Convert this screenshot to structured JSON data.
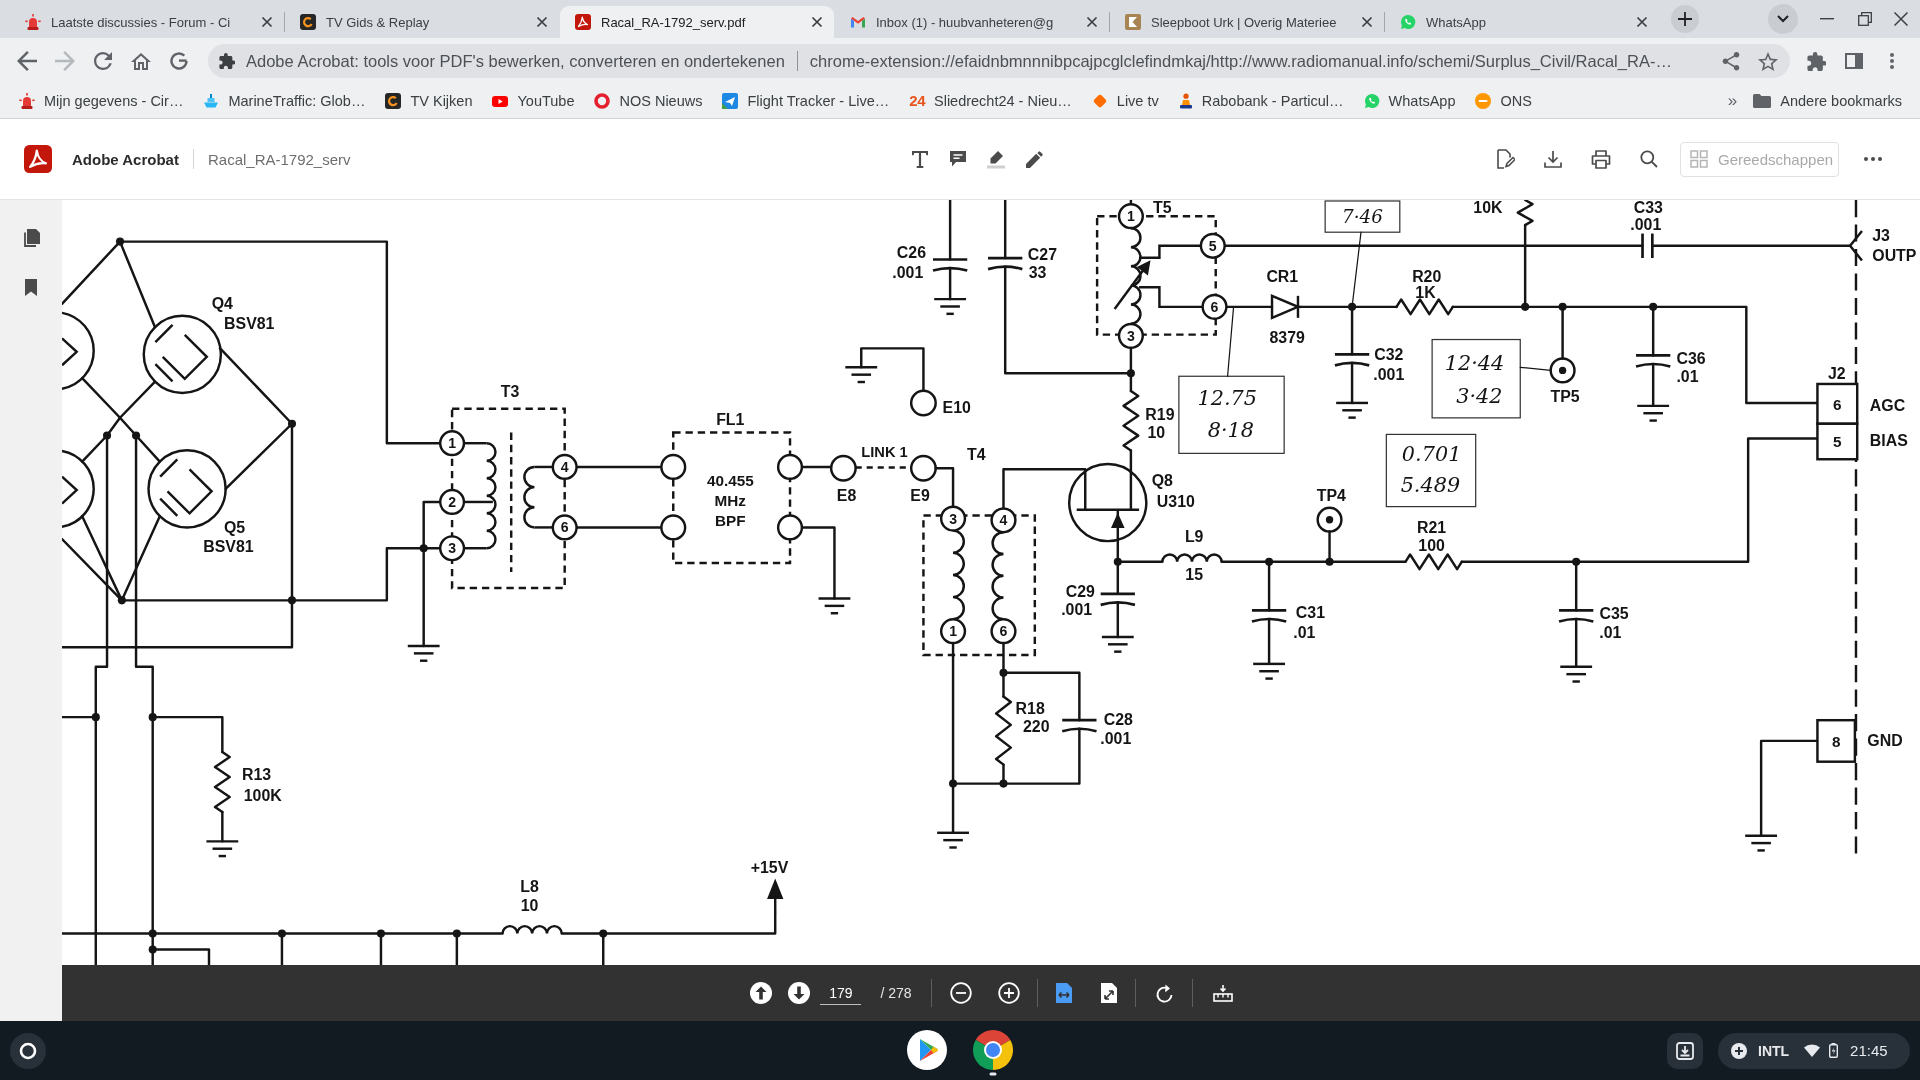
{
  "browser": {
    "tabs": [
      {
        "title": "Laatste discussies - Forum - Ci",
        "selected": false
      },
      {
        "title": "TV Gids & Replay",
        "selected": false
      },
      {
        "title": "Racal_RA-1792_serv.pdf",
        "selected": true
      },
      {
        "title": "Inbox (1) - huubvanheteren@g",
        "selected": false
      },
      {
        "title": "Sleepboot Urk | Overig Materiee",
        "selected": false
      },
      {
        "title": "WhatsApp",
        "selected": false
      }
    ],
    "navigation": {
      "back_disabled": false,
      "forward_disabled": true
    },
    "address_bar": {
      "page_title": "Adobe Acrobat: tools voor PDF's bewerken, converteren en ondertekenen",
      "url": "chrome-extension://efaidnbmnnnibpcajpcglclefindmkaj/http://www.radiomanual.info/schemi/Surplus_Civil/Racal_RA-…"
    },
    "bookmarks": [
      {
        "label": "Mijn gegevens - Cir…"
      },
      {
        "label": "MarineTraffic: Glob…"
      },
      {
        "label": "TV Kijken"
      },
      {
        "label": "YouTube"
      },
      {
        "label": "NOS Nieuws"
      },
      {
        "label": "Flight Tracker - Live…"
      },
      {
        "label": "Sliedrecht24 - Nieu…",
        "icon_text": "24"
      },
      {
        "label": "Live tv"
      },
      {
        "label": "Rabobank - Particul…"
      },
      {
        "label": "WhatsApp"
      },
      {
        "label": "ONS"
      }
    ],
    "bookmarks_overflow": "»",
    "other_bookmarks": "Andere bookmarks"
  },
  "acrobat": {
    "app_name": "Adobe Acrobat",
    "document_title": "Racal_RA-1792_serv",
    "tools_button": {
      "label": "Gereedschappen",
      "disabled": true
    }
  },
  "schematic": {
    "components": [
      {
        "kind": "transistor",
        "reference": "Q4",
        "value": "BSV81"
      },
      {
        "kind": "transistor",
        "reference": "Q5",
        "value": "BSV81"
      },
      {
        "kind": "resistor",
        "reference": "R13",
        "value": "100K"
      },
      {
        "kind": "transformer",
        "reference": "T3",
        "pins": [
          "1",
          "2",
          "3",
          "4",
          "6"
        ]
      },
      {
        "kind": "filter",
        "reference": "FL1",
        "value_lines": [
          "40.455",
          "MHz",
          "BPF"
        ]
      },
      {
        "kind": "inductor",
        "reference": "L8",
        "value": "10"
      },
      {
        "kind": "capacitor",
        "reference": "C26",
        "value": ".001"
      },
      {
        "kind": "capacitor",
        "reference": "C27",
        "value": "33"
      },
      {
        "kind": "transformer",
        "reference": "T4",
        "pins": [
          "3",
          "4",
          "1",
          "6"
        ]
      },
      {
        "kind": "resistor",
        "reference": "R18",
        "value": "220"
      },
      {
        "kind": "capacitor",
        "reference": "C28",
        "value": ".001"
      },
      {
        "kind": "transformer",
        "reference": "T5",
        "pins": [
          "1",
          "5",
          "6",
          "3"
        ]
      },
      {
        "kind": "resistor",
        "reference": "R19",
        "value": "10"
      },
      {
        "kind": "transistor",
        "reference": "Q8",
        "value": "U310"
      },
      {
        "kind": "capacitor",
        "reference": "C29",
        "value": ".001"
      },
      {
        "kind": "inductor",
        "reference": "L9",
        "value": "15"
      },
      {
        "kind": "capacitor",
        "reference": "C31",
        "value": ".01"
      },
      {
        "kind": "resistor",
        "reference": "R21",
        "value": "100"
      },
      {
        "kind": "capacitor",
        "reference": "C35",
        "value": ".01"
      },
      {
        "kind": "diode",
        "reference": "CR1",
        "value": "8379"
      },
      {
        "kind": "capacitor",
        "reference": "C32",
        "value": ".001"
      },
      {
        "kind": "resistor",
        "reference": "R20",
        "value": "1K"
      },
      {
        "kind": "resistor",
        "value": "10K"
      },
      {
        "kind": "capacitor",
        "reference": "C33",
        "value": ".001"
      },
      {
        "kind": "capacitor",
        "reference": "C36",
        "value": ".01"
      }
    ],
    "terminals": [
      {
        "label": "E8"
      },
      {
        "label": "E9"
      },
      {
        "label": "E10"
      }
    ],
    "link_label": "LINK 1",
    "test_points": [
      {
        "label": "TP4"
      },
      {
        "label": "TP5"
      }
    ],
    "supply": {
      "label": "+15V"
    },
    "connectors": [
      {
        "kind": "jack",
        "reference": "J3",
        "signal": "OUTP"
      },
      {
        "kind": "pin_block",
        "reference": "J2",
        "pins": [
          {
            "number": "6",
            "signal": "AGC"
          },
          {
            "number": "5",
            "signal": "BIAS"
          },
          {
            "number": "8",
            "signal": "GND"
          }
        ]
      }
    ],
    "notes": [
      {
        "lines": [
          "7·46"
        ]
      },
      {
        "lines": [
          "12.75",
          "8·18"
        ]
      },
      {
        "lines": [
          "12·44",
          "3·42"
        ]
      },
      {
        "lines": [
          "0.701",
          "5.489"
        ]
      }
    ]
  },
  "page_controls": {
    "page_number": "179",
    "page_total": "/ 278",
    "view_buttons": [
      {
        "selected": true
      },
      {
        "selected": false
      }
    ]
  },
  "shelf": {
    "apps": [
      {
        "running": false
      },
      {
        "running": true
      }
    ],
    "keyboard_layout": "INTL",
    "clock": "21:45"
  }
}
